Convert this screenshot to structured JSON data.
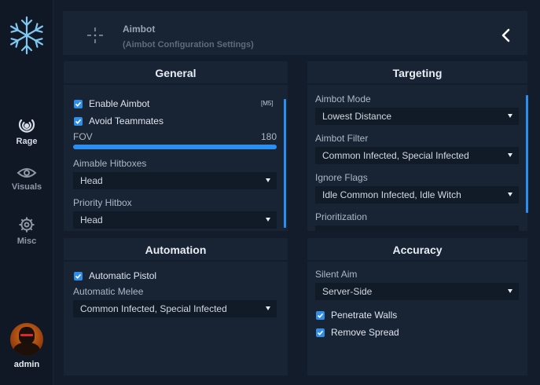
{
  "sidebar": {
    "logo_icon": "snowflake-icon",
    "items": [
      {
        "label": "Rage",
        "icon": "target-icon",
        "active": true
      },
      {
        "label": "Visuals",
        "icon": "eye-icon",
        "active": false
      },
      {
        "label": "Misc",
        "icon": "gear-icon",
        "active": false
      }
    ],
    "user": {
      "name": "admin",
      "icon": "avatar"
    }
  },
  "header": {
    "title": "Aimbot",
    "subtitle": "(Aimbot Configuration Settings)",
    "icon": "crosshair-icon",
    "back_icon": "chevron-left-icon"
  },
  "general": {
    "title": "General",
    "enable_aimbot": {
      "label": "Enable Aimbot",
      "checked": true,
      "keybind": "[M5]"
    },
    "avoid_teammates": {
      "label": "Avoid Teammates",
      "checked": true
    },
    "fov": {
      "label": "FOV",
      "value": "180",
      "fill": 1.0
    },
    "aimable_hitboxes": {
      "label": "Aimable Hitboxes",
      "value": "Head"
    },
    "priority_hitbox": {
      "label": "Priority Hitbox",
      "value": "Head"
    }
  },
  "targeting": {
    "title": "Targeting",
    "aimbot_mode": {
      "label": "Aimbot Mode",
      "value": "Lowest Distance"
    },
    "aimbot_filter": {
      "label": "Aimbot Filter",
      "value": "Common Infected, Special Infected"
    },
    "ignore_flags": {
      "label": "Ignore Flags",
      "value": "Idle Common Infected, Idle Witch"
    },
    "prioritization": {
      "label": "Prioritization"
    }
  },
  "automation": {
    "title": "Automation",
    "automatic_pistol": {
      "label": "Automatic Pistol",
      "checked": true
    },
    "automatic_melee": {
      "label": "Automatic Melee",
      "value": "Common Infected, Special Infected"
    }
  },
  "accuracy": {
    "title": "Accuracy",
    "silent_aim": {
      "label": "Silent Aim",
      "value": "Server-Side"
    },
    "penetrate_walls": {
      "label": "Penetrate Walls",
      "checked": true
    },
    "remove_spread": {
      "label": "Remove Spread",
      "checked": true
    }
  },
  "colors": {
    "accent": "#2a8ff0",
    "panel": "#182334",
    "background": "#131c2b"
  }
}
